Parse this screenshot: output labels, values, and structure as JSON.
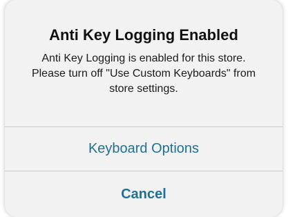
{
  "alert": {
    "title": "Anti Key Logging Enabled",
    "message": "Anti Key Logging is enabled for this store. Please turn off \"Use Custom Keyboards\" from store settings.",
    "buttons": {
      "keyboard_options": "Keyboard Options",
      "cancel": "Cancel"
    }
  },
  "colors": {
    "background": "#f2f2f3",
    "button_text": "#1e7193",
    "divider": "#c9c9cc"
  }
}
